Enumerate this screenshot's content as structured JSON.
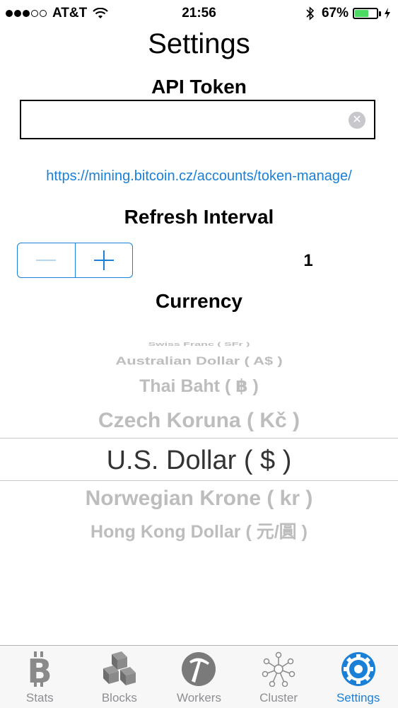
{
  "status_bar": {
    "carrier": "AT&T",
    "time": "21:56",
    "battery": "67%",
    "battery_level": 0.67,
    "signal_bars_filled": 3,
    "signal_bars_total": 5
  },
  "page": {
    "title": "Settings"
  },
  "api_token": {
    "label": "API Token",
    "value": "",
    "placeholder": "",
    "link": "https://mining.bitcoin.cz/accounts/token-manage/"
  },
  "refresh": {
    "label": "Refresh Interval",
    "value": "1"
  },
  "currency": {
    "label": "Currency",
    "options": [
      "Swiss Franc ( SFr )",
      "Australian Dollar ( A$ )",
      "Thai Baht ( ฿ )",
      "Czech Koruna ( Kč )",
      "U.S. Dollar ( $ )",
      "Norwegian Krone ( kr )",
      "Hong Kong Dollar ( 元/圓 )"
    ],
    "selected": "U.S. Dollar ( $ )"
  },
  "tab_bar": {
    "tabs": [
      {
        "label": "Stats",
        "icon": "bitcoin-icon"
      },
      {
        "label": "Blocks",
        "icon": "blocks-icon"
      },
      {
        "label": "Workers",
        "icon": "pickaxe-icon"
      },
      {
        "label": "Cluster",
        "icon": "cluster-icon"
      },
      {
        "label": "Settings",
        "icon": "gear-icon"
      }
    ],
    "active": "Settings"
  },
  "colors": {
    "accent": "#1a7fd6",
    "battery": "#4cd964",
    "tab_inactive": "#8e8e93",
    "picker_faded": "#bdbdbd"
  }
}
